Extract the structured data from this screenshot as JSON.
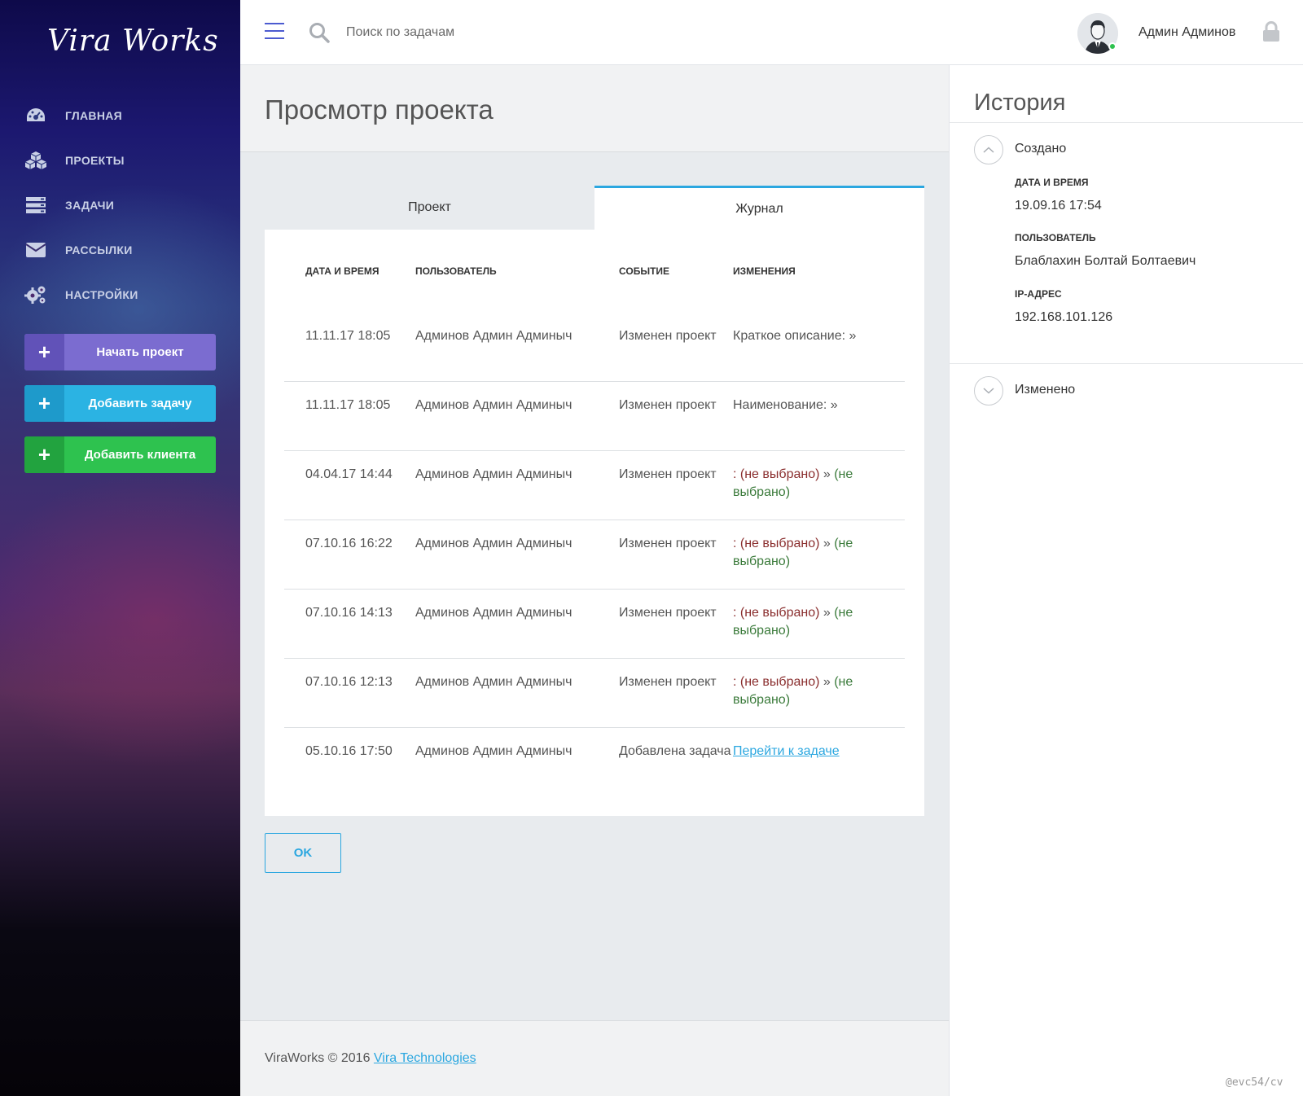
{
  "app": {
    "logo": "Vira Works"
  },
  "sidebar": {
    "nav": [
      {
        "label": "ГЛАВНАЯ",
        "icon": "dashboard-icon"
      },
      {
        "label": "ПРОЕКТЫ",
        "icon": "cubes-icon"
      },
      {
        "label": "ЗАДАЧИ",
        "icon": "tasks-icon"
      },
      {
        "label": "РАССЫЛКИ",
        "icon": "envelope-icon"
      },
      {
        "label": "НАСТРОЙКИ",
        "icon": "gears-icon"
      }
    ],
    "actions": {
      "start_project": "Начать проект",
      "add_task": "Добавить задачу",
      "add_client": "Добавить клиента",
      "plus": "+"
    }
  },
  "topbar": {
    "search_placeholder": "Поиск по задачам",
    "user_name": "Админ Админов"
  },
  "page": {
    "title": "Просмотр проекта"
  },
  "tabs": {
    "project": "Проект",
    "journal": "Журнал",
    "active": "journal"
  },
  "journal": {
    "headers": {
      "date": "ДАТА И ВРЕМЯ",
      "user": "ПОЛЬЗОВАТЕЛЬ",
      "event": "СОБЫТИЕ",
      "changes": "ИЗМЕНЕНИЯ"
    },
    "rows": [
      {
        "date": "11.11.17 18:05",
        "user": "Админов Админ Админыч",
        "event": "Изменен проект",
        "change_plain": "Краткое описание: »"
      },
      {
        "date": "11.11.17 18:05",
        "user": "Админов Админ Админыч",
        "event": "Изменен проект",
        "change_plain": "Наименование: »"
      },
      {
        "date": "04.04.17 14:44",
        "user": "Админов Админ Админыч",
        "event": "Изменен проект",
        "change_prefix": ": ",
        "change_old": "(не выбрано)",
        "change_sep": " » ",
        "change_new": "(не выбрано)"
      },
      {
        "date": "07.10.16 16:22",
        "user": "Админов Админ Админыч",
        "event": "Изменен проект",
        "change_prefix": ": ",
        "change_old": "(не выбрано)",
        "change_sep": " » ",
        "change_new": "(не выбрано)"
      },
      {
        "date": "07.10.16 14:13",
        "user": "Админов Админ Админыч",
        "event": "Изменен проект",
        "change_prefix": ": ",
        "change_old": "(не выбрано)",
        "change_sep": " » ",
        "change_new": "(не выбрано)"
      },
      {
        "date": "07.10.16 12:13",
        "user": "Админов Админ Админыч",
        "event": "Изменен проект",
        "change_prefix": ": ",
        "change_old": "(не выбрано)",
        "change_sep": " » ",
        "change_new": "(не выбрано)"
      },
      {
        "date": "05.10.16 17:50",
        "user": "Админов Админ Админыч",
        "event": "Добавлена задача",
        "change_link": "Перейти к задаче"
      }
    ]
  },
  "ok_button": "OK",
  "footer": {
    "text": "ViraWorks © 2016 ",
    "link": "Vira Technologies"
  },
  "history": {
    "title": "История",
    "created": {
      "heading": "Создано",
      "date_label": "ДАТА И ВРЕМЯ",
      "date_value": "19.09.16 17:54",
      "user_label": "ПОЛЬЗОВАТЕЛЬ",
      "user_value": "Блаблахин Болтай Болтаевич",
      "ip_label": "IP-АДРЕС",
      "ip_value": "192.168.101.126"
    },
    "changed": {
      "heading": "Изменено"
    }
  },
  "watermark": "@evc54/cv",
  "colors": {
    "accent": "#2ba7e0",
    "start_project": "#7b6cd0",
    "add_task": "#2bb3e3",
    "add_client": "#2ec24f",
    "online": "#2ec24f",
    "change_old": "#8a2e2e",
    "change_new": "#3a7a3a"
  }
}
